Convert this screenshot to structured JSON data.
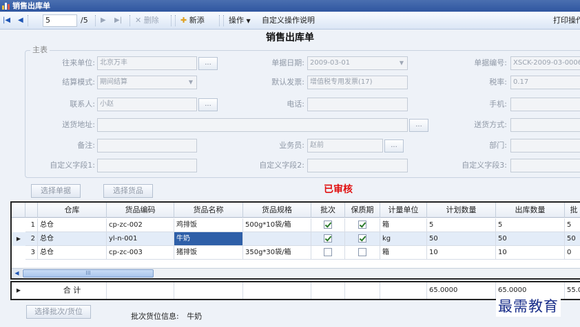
{
  "window": {
    "title": "销售出库单"
  },
  "toolbar": {
    "record_pos": "5",
    "record_total": "/5",
    "delete_label": "删除",
    "new_label": "新添",
    "ops_label": "操作",
    "custom_ops_label": "自定义操作说明",
    "print_label": "打印操作"
  },
  "form": {
    "title": "销售出库单",
    "legend": "主表",
    "fields": {
      "partner": {
        "label": "往来单位:",
        "value": "北京万丰"
      },
      "doc_date": {
        "label": "单据日期:",
        "value": "2009-03-01"
      },
      "doc_no": {
        "label": "单据编号:",
        "value": "XSCK-2009-03-0006"
      },
      "settle": {
        "label": "结算模式:",
        "value": "期间结算"
      },
      "invoice": {
        "label": "默认发票:",
        "value": "增值税专用发票(17)"
      },
      "tax": {
        "label": "税率:",
        "value": "0.17"
      },
      "contact": {
        "label": "联系人:",
        "value": "小赵"
      },
      "phone": {
        "label": "电话:",
        "value": ""
      },
      "mobile": {
        "label": "手机:",
        "value": ""
      },
      "address": {
        "label": "送货地址:",
        "value": ""
      },
      "ship_method": {
        "label": "送货方式:",
        "value": ""
      },
      "remark": {
        "label": "备注:",
        "value": ""
      },
      "salesman": {
        "label": "业务员:",
        "value": "赵前"
      },
      "dept": {
        "label": "部门:",
        "value": ""
      },
      "custom1": {
        "label": "自定义字段1:",
        "value": ""
      },
      "custom2": {
        "label": "自定义字段2:",
        "value": ""
      },
      "custom3": {
        "label": "自定义字段3:",
        "value": ""
      }
    },
    "dots": "...",
    "select_doc_btn": "选择单据",
    "select_goods_btn": "选择货品",
    "status": "已审核"
  },
  "grid": {
    "columns": [
      "仓库",
      "货品编码",
      "货品名称",
      "货品规格",
      "批次",
      "保质期",
      "计量单位",
      "计划数量",
      "出库数量",
      "批"
    ],
    "rows": [
      {
        "n": "1",
        "warehouse": "总仓",
        "code": "cp-zc-002",
        "name": "鸡排饭",
        "spec": "500g*10袋/箱",
        "batch": true,
        "shelf": true,
        "unit": "箱",
        "plan": "5",
        "out": "5",
        "extra": "5"
      },
      {
        "n": "2",
        "warehouse": "总仓",
        "code": "yl-n-001",
        "name": "牛奶",
        "spec": "",
        "batch": true,
        "shelf": true,
        "unit": "kg",
        "plan": "50",
        "out": "50",
        "extra": "50"
      },
      {
        "n": "3",
        "warehouse": "总仓",
        "code": "cp-zc-003",
        "name": "猪排饭",
        "spec": "350g*30袋/箱",
        "batch": false,
        "shelf": false,
        "unit": "箱",
        "plan": "10",
        "out": "10",
        "extra": "0"
      }
    ],
    "scroll_grip": "III",
    "total": {
      "label": "合 计",
      "plan": "65.0000",
      "out": "65.0000",
      "extra": "55.0"
    }
  },
  "bottom": {
    "select_batch_btn": "选择批次/货位",
    "batch_info_label": "批次货位信息:",
    "batch_info_value": "牛奶"
  },
  "watermark": "最需教育",
  "colors": {
    "accent": "#2e5fa8",
    "status": "#e01010"
  }
}
